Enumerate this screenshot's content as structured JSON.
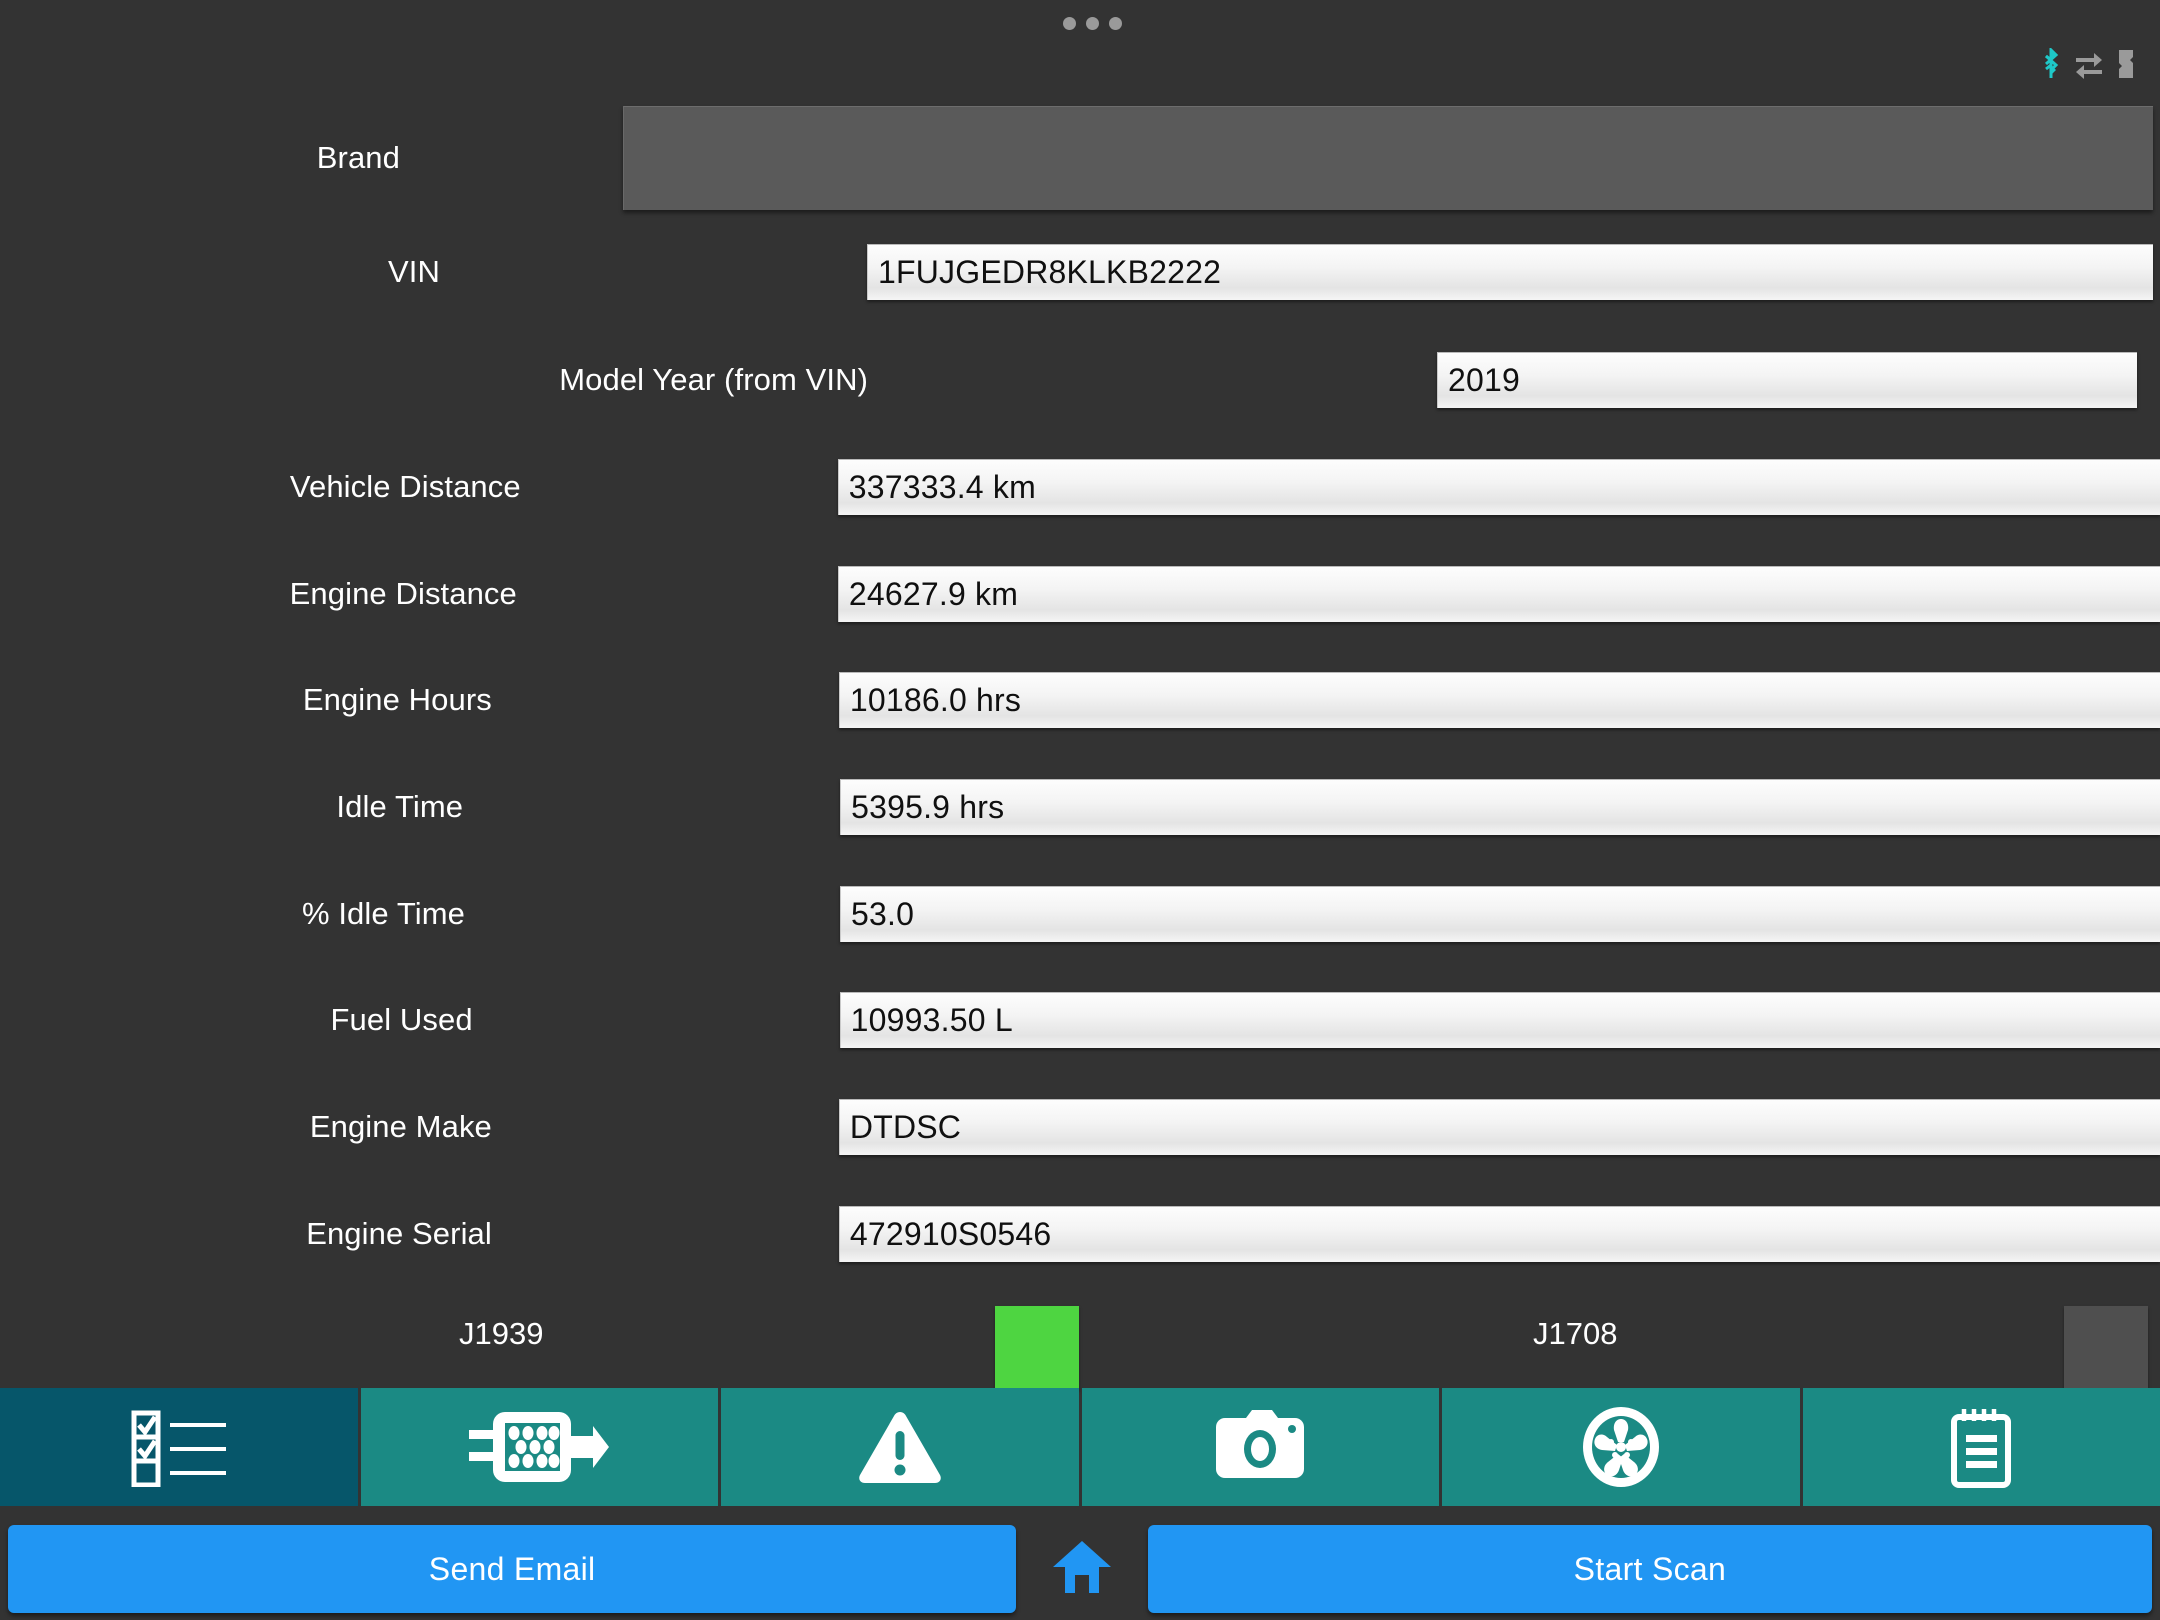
{
  "topbar": {
    "menu_icon": "overflow-menu-dots",
    "status_icons": [
      {
        "name": "bluetooth-icon",
        "color": "#1ec8c8"
      },
      {
        "name": "data-transfer-icon",
        "color": "#9a9a9a"
      },
      {
        "name": "battery-icon",
        "color": "#9a9a9a"
      }
    ]
  },
  "form": {
    "rows": [
      {
        "label": "Brand",
        "value": "",
        "type": "select"
      },
      {
        "label": "VIN",
        "value": "1FUJGEDR8KLKB2222",
        "type": "text"
      },
      {
        "label": "Model Year (from VIN)",
        "value": "2019",
        "type": "text"
      },
      {
        "label": "Vehicle Distance",
        "value": "337333.4 km",
        "type": "text"
      },
      {
        "label": "Engine Distance",
        "value": "24627.9 km",
        "type": "text"
      },
      {
        "label": "Engine Hours",
        "value": "10186.0 hrs",
        "type": "text"
      },
      {
        "label": "Idle Time",
        "value": "5395.9 hrs",
        "type": "text"
      },
      {
        "label": "% Idle Time",
        "value": "53.0",
        "type": "text"
      },
      {
        "label": "Fuel Used",
        "value": "10993.50 L",
        "type": "text"
      },
      {
        "label": "Engine Make",
        "value": "DTDSC",
        "type": "text"
      },
      {
        "label": "Engine Serial",
        "value": "472910S0546",
        "type": "text"
      }
    ]
  },
  "bus_status": {
    "j1939_label": "J1939",
    "j1939_state": "active",
    "j1939_color": "#4ed541",
    "j1708_label": "J1708",
    "j1708_state": "inactive",
    "j1708_color": "#4f4f4f"
  },
  "toolbar": {
    "active_color": "#06566a",
    "inactive_color": "#1b8a84",
    "items": [
      {
        "name": "checklist-icon",
        "active": true
      },
      {
        "name": "connector-icon",
        "active": false
      },
      {
        "name": "warning-icon",
        "active": false
      },
      {
        "name": "camera-icon",
        "active": false
      },
      {
        "name": "wheel-icon",
        "active": false
      },
      {
        "name": "notepad-icon",
        "active": false
      }
    ]
  },
  "actions": {
    "send_email_label": "Send Email",
    "home_icon": "home-icon",
    "start_scan_label": "Start Scan",
    "accent_color": "#2196f3"
  }
}
